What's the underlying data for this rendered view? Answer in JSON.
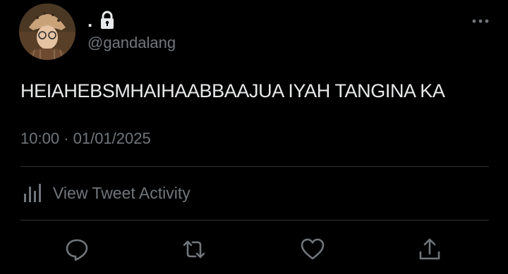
{
  "user": {
    "display_name": ".",
    "handle": "@gandalang",
    "lock_icon": "lock-icon",
    "avatar_icon": "avatar"
  },
  "tweet": {
    "text": "HEIAHEBSMHAIHAABBAAJUA IYAH TANGINA KA",
    "timestamp": "10:00 · 01/01/2025"
  },
  "activity": {
    "label": "View Tweet Activity",
    "icon": "bar-chart-icon"
  },
  "actions": {
    "reply_icon": "reply-icon",
    "retweet_icon": "retweet-icon",
    "like_icon": "heart-icon",
    "share_icon": "share-icon"
  },
  "colors": {
    "background": "#000000",
    "primary_text": "#e7e9ea",
    "secondary_text": "#71767b",
    "divider": "#2f3336"
  }
}
